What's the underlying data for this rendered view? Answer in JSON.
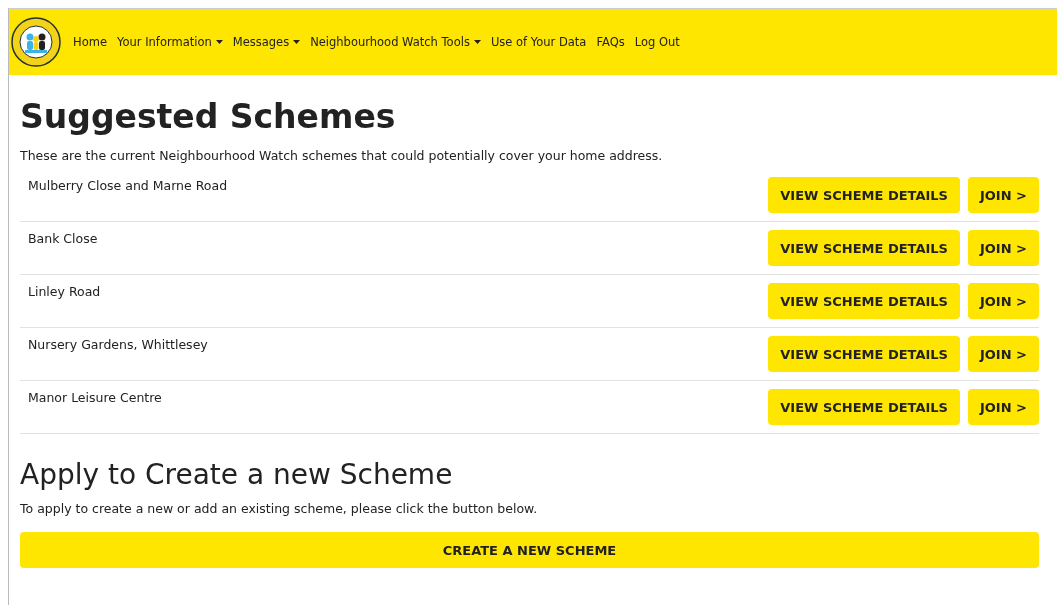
{
  "nav": {
    "items": [
      {
        "label": "Home",
        "kind": "link"
      },
      {
        "label": "Your Information",
        "kind": "dropdown"
      },
      {
        "label": "Messages",
        "kind": "dropdown"
      },
      {
        "label": "Neighbourhood Watch Tools",
        "kind": "dropdown"
      },
      {
        "label": "Use of Your Data",
        "kind": "link"
      },
      {
        "label": "FAQs",
        "kind": "link"
      },
      {
        "label": "Log Out",
        "kind": "link"
      }
    ]
  },
  "heading": "Suggested Schemes",
  "intro": "These are the current Neighbourhood Watch schemes that could potentially cover your home address.",
  "schemes": [
    {
      "name": "Mulberry Close and Marne Road",
      "details_button": "VIEW SCHEME DETAILS",
      "join_button": "JOIN >"
    },
    {
      "name": "Bank Close",
      "details_button": "VIEW SCHEME DETAILS",
      "join_button": "JOIN >"
    },
    {
      "name": "Linley Road",
      "details_button": "VIEW SCHEME DETAILS",
      "join_button": "JOIN >"
    },
    {
      "name": "Nursery Gardens, Whittlesey",
      "details_button": "VIEW SCHEME DETAILS",
      "join_button": "JOIN >"
    },
    {
      "name": "Manor Leisure Centre",
      "details_button": "VIEW SCHEME DETAILS",
      "join_button": "JOIN >"
    }
  ],
  "create": {
    "heading": "Apply to Create a new Scheme",
    "text": "To apply to create a new or add an existing scheme, please click the button below.",
    "button": "CREATE A NEW SCHEME"
  }
}
